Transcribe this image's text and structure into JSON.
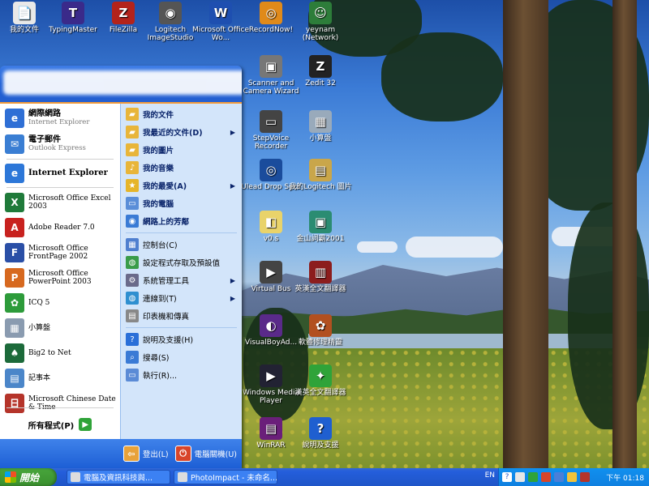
{
  "desktop": {
    "icons": [
      {
        "label": "我的文件",
        "symbol": "📄",
        "color": "#e8e8e8"
      },
      {
        "label": "TypingMaster",
        "symbol": "T",
        "color": "#3a2a8a"
      },
      {
        "label": "FileZilla",
        "symbol": "Z",
        "color": "#b3231b"
      },
      {
        "label": "Logitech ImageStudio",
        "symbol": "◉",
        "color": "#555"
      },
      {
        "label": "Microsoft Office Wo...",
        "symbol": "W",
        "color": "#1e4fb0"
      },
      {
        "label": "RecordNow!",
        "symbol": "◎",
        "color": "#e08a1a"
      },
      {
        "label": "yeynam (Network)",
        "symbol": "☺",
        "color": "#2d7d3a"
      },
      {
        "label": "Scanner and Camera Wizard",
        "symbol": "▣",
        "color": "#777"
      },
      {
        "label": "Zedit 32",
        "symbol": "Z",
        "color": "#222"
      },
      {
        "label": "StepVoice Recorder",
        "symbol": "▭",
        "color": "#444"
      },
      {
        "label": "小算盤",
        "symbol": "▦",
        "color": "#9ab"
      },
      {
        "label": "Ulead Drop Spot",
        "symbol": "◎",
        "color": "#1a4c9c"
      },
      {
        "label": "我的Logitech 圖片",
        "symbol": "▤",
        "color": "#c9a64a"
      },
      {
        "label": "v0.s",
        "symbol": "◧",
        "color": "#e9d36a"
      },
      {
        "label": "金山詞霸2001",
        "symbol": "▣",
        "color": "#2b8c72"
      },
      {
        "label": "Virtual Bus",
        "symbol": "▶",
        "color": "#444"
      },
      {
        "label": "英漢全文翻譯器",
        "symbol": "▥",
        "color": "#8c1d1d"
      },
      {
        "label": "VisualBoyAd...",
        "symbol": "◐",
        "color": "#5a2a8a"
      },
      {
        "label": "軟體修理精靈",
        "symbol": "✿",
        "color": "#b25020"
      },
      {
        "label": "Windows Media Player",
        "symbol": "▶",
        "color": "#223"
      },
      {
        "label": "漢英全文翻譯器",
        "symbol": "✦",
        "color": "#2fa339"
      },
      {
        "label": "WinRAR",
        "symbol": "▤",
        "color": "#6a1f7a"
      },
      {
        "label": "說明及支援",
        "symbol": "?",
        "color": "#1f5fd0"
      }
    ]
  },
  "start_menu": {
    "pinned": [
      {
        "title": "網際網路",
        "subtitle": "Internet Explorer",
        "symbol": "e",
        "color": "#2f6fd5"
      },
      {
        "title": "電子郵件",
        "subtitle": "Outlook Express",
        "symbol": "✉",
        "color": "#3a7ed3"
      }
    ],
    "recent": [
      {
        "title": "Internet Explorer",
        "symbol": "e",
        "color": "#2d77d8",
        "bold": true
      },
      {
        "title": "Microsoft Office Excel 2003",
        "symbol": "X",
        "color": "#1f7a3a"
      },
      {
        "title": "Adobe Reader 7.0",
        "symbol": "A",
        "color": "#c8221f"
      },
      {
        "title": "Microsoft Office FrontPage 2002",
        "symbol": "F",
        "color": "#2a4fa6"
      },
      {
        "title": "Microsoft Office PowerPoint 2003",
        "symbol": "P",
        "color": "#d7691f"
      },
      {
        "title": "ICQ 5",
        "symbol": "✿",
        "color": "#2d9b3a"
      },
      {
        "title": "小算盤",
        "symbol": "▦",
        "color": "#8a9bb0"
      },
      {
        "title": "Big2 to Net",
        "symbol": "♠",
        "color": "#1c6a3a"
      },
      {
        "title": "記事本",
        "symbol": "▤",
        "color": "#4b86c9"
      },
      {
        "title": "Microsoft Chinese Date & Time",
        "symbol": "日",
        "color": "#b5342a"
      }
    ],
    "all_programs": "所有程式(P)",
    "right": [
      {
        "label": "我的文件",
        "symbol": "▰",
        "color": "#e8b53a",
        "bold": true
      },
      {
        "label": "我最近的文件(D)",
        "symbol": "▰",
        "color": "#e8b53a",
        "bold": true,
        "arrow": "▶"
      },
      {
        "label": "我的圖片",
        "symbol": "▰",
        "color": "#e8b53a",
        "bold": true
      },
      {
        "label": "我的音樂",
        "symbol": "♪",
        "color": "#e8b53a",
        "bold": true
      },
      {
        "label": "我的最愛(A)",
        "symbol": "★",
        "color": "#e6b52a",
        "bold": true,
        "arrow": "▶"
      },
      {
        "label": "我的電腦",
        "symbol": "▭",
        "color": "#5a8ed8",
        "bold": true
      },
      {
        "label": "網路上的芳鄰",
        "symbol": "◉",
        "color": "#3a7bd5",
        "bold": true
      },
      {
        "label": "控制台(C)",
        "symbol": "▦",
        "color": "#4f7fcf"
      },
      {
        "label": "設定程式存取及預設值",
        "symbol": "◍",
        "color": "#3a9c4a"
      },
      {
        "label": "系統管理工具",
        "symbol": "⚙",
        "color": "#6a6a8a",
        "arrow": "▶"
      },
      {
        "label": "連線到(T)",
        "symbol": "◍",
        "color": "#2f8fd0",
        "arrow": "▶"
      },
      {
        "label": "印表機和傳真",
        "symbol": "▤",
        "color": "#888"
      },
      {
        "label": "說明及支援(H)",
        "symbol": "?",
        "color": "#2a6fd8"
      },
      {
        "label": "搜尋(S)",
        "symbol": "⌕",
        "color": "#3a7ad5"
      },
      {
        "label": "執行(R)...",
        "symbol": "▭",
        "color": "#5b8bd6"
      }
    ],
    "footer": {
      "logoff": "登出(L)",
      "shutdown": "電腦關機(U)"
    }
  },
  "taskbar": {
    "start": "開始",
    "tasks": [
      {
        "label": "電腦及資訊科技與..."
      },
      {
        "label": "PhotoImpact - 未命名..."
      }
    ],
    "language": "EN",
    "clock": "下午 01:18"
  }
}
